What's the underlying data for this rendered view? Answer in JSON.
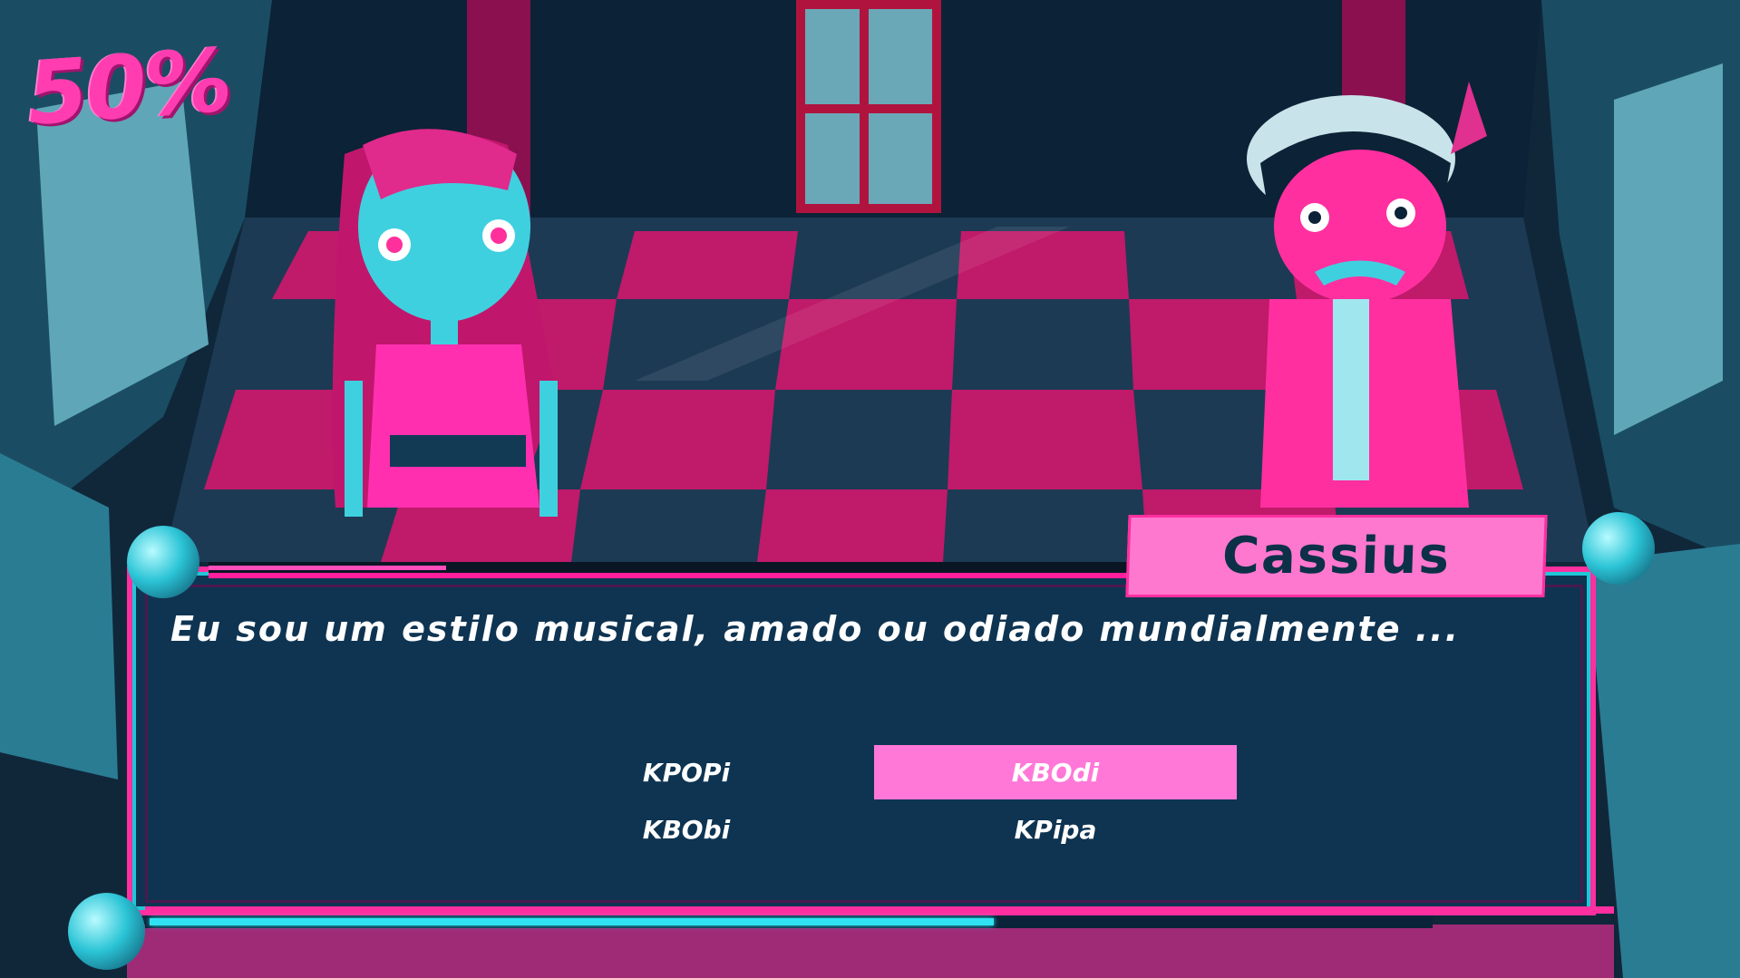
{
  "hud": {
    "progress_label": "50%"
  },
  "dialog": {
    "speaker": "Cassius",
    "line": "Eu sou um estilo musical, amado ou odiado mundialmente ...",
    "choices": [
      {
        "label": "KPOPi",
        "selected": false
      },
      {
        "label": "KBOdi",
        "selected": true
      },
      {
        "label": "KBObi",
        "selected": false
      },
      {
        "label": "KPipa",
        "selected": false
      }
    ],
    "timer_fraction": 0.66
  },
  "colors": {
    "accent": "#ff2fa0",
    "choice_highlight": "#ff78d8",
    "timer": "#2fe3f2",
    "panel": "#0e3452"
  }
}
